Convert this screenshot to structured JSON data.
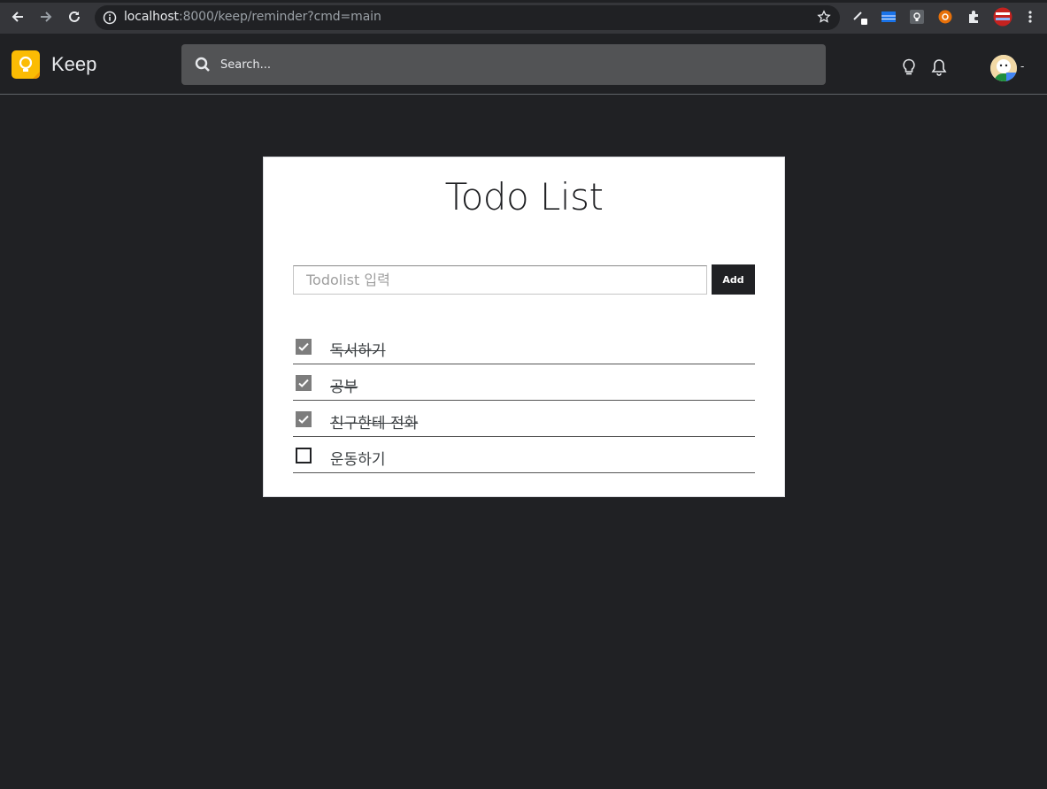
{
  "browser": {
    "url_host": "localhost",
    "url_rest": ":8000/keep/reminder?cmd=main",
    "icons": [
      "back-arrow-icon",
      "forward-arrow-icon",
      "reload-icon",
      "info-icon",
      "bookmark-star-icon",
      "extension-pen-icon",
      "extension-flag-icon",
      "extension-keep-icon",
      "extension-orange-icon",
      "puzzle-extensions-icon",
      "profile-icon",
      "more-vert-icon"
    ]
  },
  "header": {
    "app_title": "Keep",
    "search_placeholder": "Search...",
    "avatar_caret": "-",
    "icons": [
      "lightbulb-icon",
      "bell-icon"
    ]
  },
  "todo": {
    "title": "Todo List",
    "input_placeholder": "Todolist 입력",
    "add_label": "Add",
    "items": [
      {
        "text": "독서하기",
        "done": true
      },
      {
        "text": "공부",
        "done": true
      },
      {
        "text": "친구한테 전화",
        "done": true
      },
      {
        "text": "운동하기",
        "done": false
      }
    ]
  },
  "colors": {
    "background": "#202124",
    "card": "#ffffff",
    "accent_logo": "#fbbc04",
    "checked_box": "#7d7d7d"
  }
}
